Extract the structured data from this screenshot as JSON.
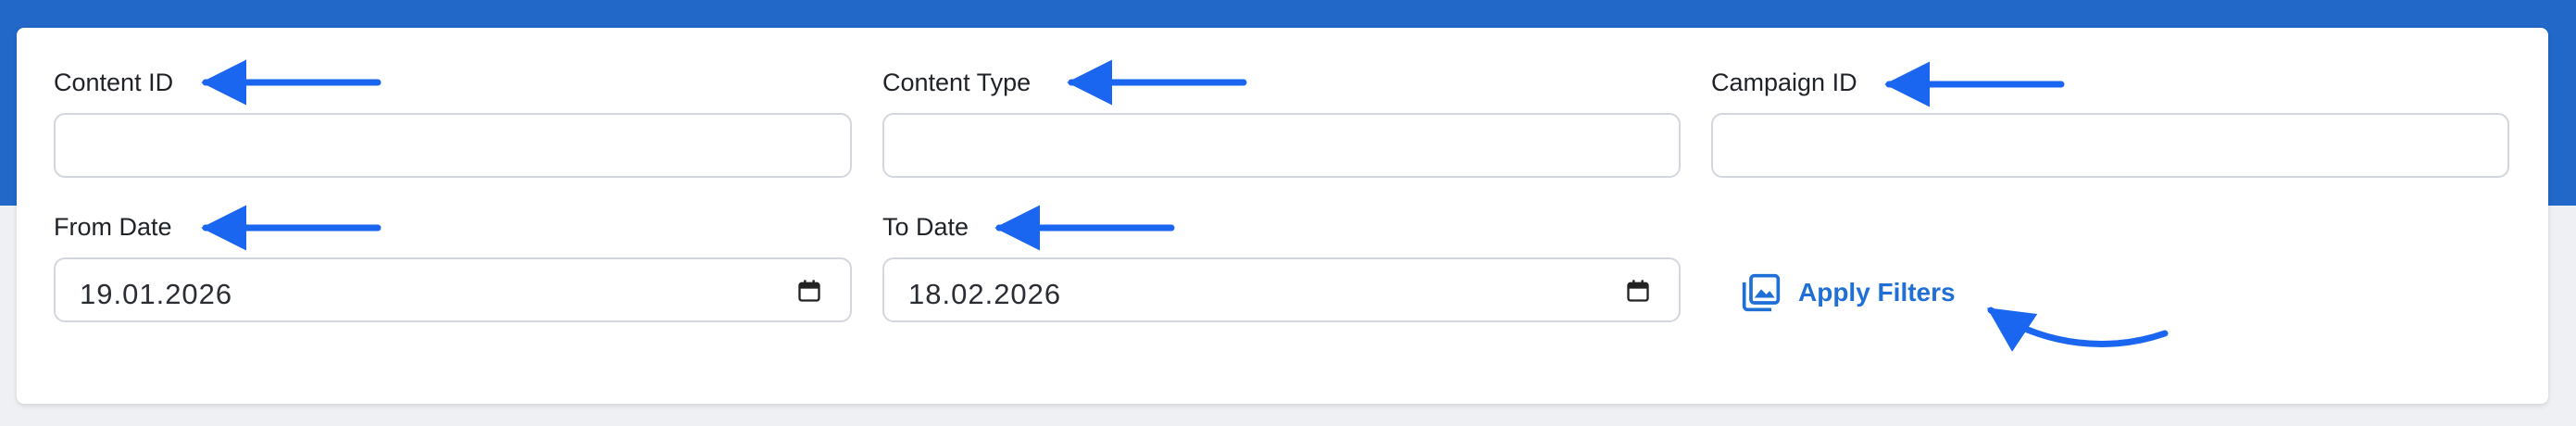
{
  "filters": {
    "content_id": {
      "label": "Content ID",
      "value": ""
    },
    "content_type": {
      "label": "Content Type",
      "value": ""
    },
    "campaign_id": {
      "label": "Campaign ID",
      "value": ""
    },
    "from_date": {
      "label": "From Date",
      "value": "19.01.2026"
    },
    "to_date": {
      "label": "To Date",
      "value": "18.02.2026"
    }
  },
  "actions": {
    "apply_label": "Apply Filters",
    "apply_icon": "image-gallery-icon"
  },
  "icons": {
    "date_picker": "calendar-icon",
    "annotation": "arrow-icon"
  },
  "colors": {
    "header_band": "#2268c8",
    "accent": "#1f6fd6",
    "annotation_arrow": "#1a66f0"
  }
}
